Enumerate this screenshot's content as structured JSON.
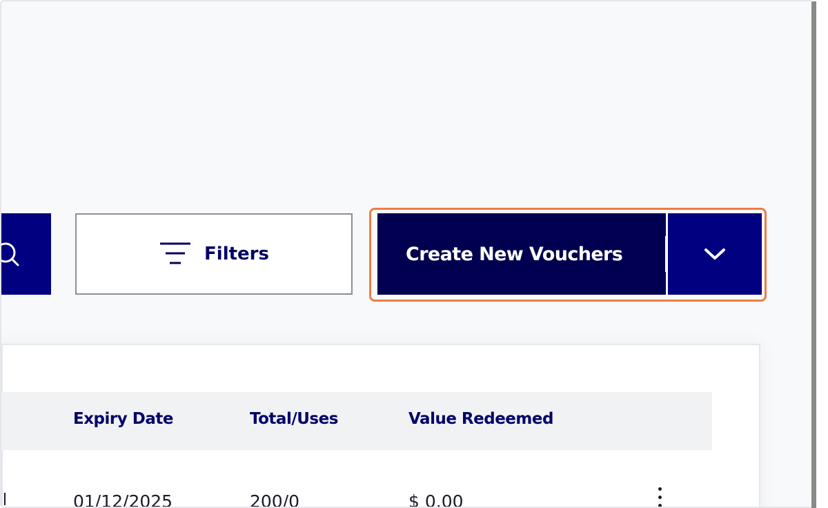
{
  "toolbar": {
    "filters_label": "Filters",
    "create_label": "Create New Vouchers"
  },
  "table": {
    "columns": [
      "Expiry Date",
      "Total/Uses",
      "Value Redeemed"
    ],
    "rows": [
      {
        "expiry": "01/12/2025",
        "total_uses": "200/0",
        "value_redeemed": "$ 0.00"
      }
    ]
  },
  "icons": {
    "search": "search-icon",
    "filter": "filter-icon",
    "chevron": "chevron-down-icon",
    "more": "more-vertical-icon"
  },
  "colors": {
    "primary": "#010080",
    "primary_dark": "#010050",
    "header_text": "#02026a",
    "focus_ring": "#f07a45"
  }
}
